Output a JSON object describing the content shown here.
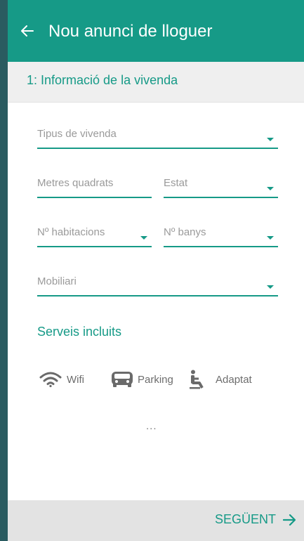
{
  "header": {
    "title": "Nou anunci de lloguer",
    "back_icon": "arrow-left-icon",
    "color": "#169a87"
  },
  "step": {
    "label": "1: Informació de la vivenda"
  },
  "form": {
    "property_type": {
      "placeholder": "Tipus de vivenda"
    },
    "square_meters": {
      "placeholder": "Metres quadrats"
    },
    "state": {
      "placeholder": "Estat"
    },
    "rooms": {
      "placeholder": "Nº habitacions"
    },
    "bathrooms": {
      "placeholder": "Nº banys"
    },
    "furniture": {
      "placeholder": "Mobiliari"
    }
  },
  "services": {
    "title": "Serveis incluits",
    "items": [
      {
        "label": "Wifi",
        "icon": "wifi-icon"
      },
      {
        "label": "Parking",
        "icon": "car-icon"
      },
      {
        "label": "Adaptat",
        "icon": "accessible-icon"
      }
    ],
    "more": "..."
  },
  "footer": {
    "next_label": "SEGÜENT",
    "next_icon": "arrow-right-icon"
  },
  "colors": {
    "accent": "#169a87",
    "background": "#2a5b60"
  }
}
